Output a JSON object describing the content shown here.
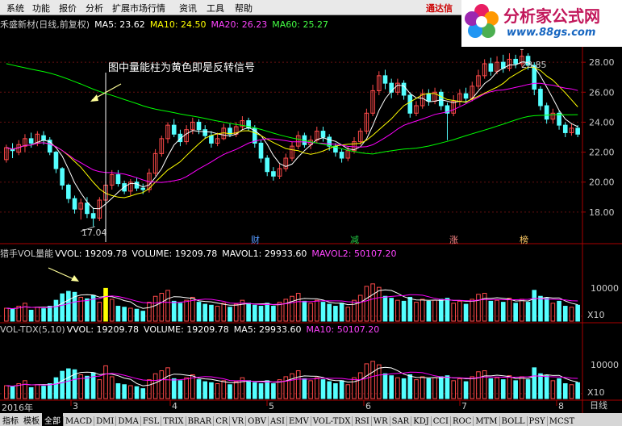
{
  "menu": [
    "系统",
    "功能",
    "报价",
    "分析",
    "扩展市场行情",
    "资讯",
    "工具",
    "帮助"
  ],
  "menu_brand": "通达信",
  "logo": {
    "name": "分析家公式网",
    "url": "www.88gs.com"
  },
  "colors": {
    "up": "#ff4a4a",
    "down": "#54ffff",
    "ma5": "#ffffff",
    "ma10": "#ffff00",
    "ma20": "#ff00ff",
    "ma60": "#00ff00",
    "vol_special": "#ffff00",
    "label": "#cccccc",
    "axis": "#aa0000"
  },
  "price_panel": {
    "title": "禾盛新材(日线,前复权)",
    "ma5_label": "MA5: 23.62",
    "ma10_label": "MA10: 24.50",
    "ma20_label": "MA20: 26.23",
    "ma60_label": "MA60: 25.27",
    "annotation": "图中量能柱为黄色即是反转信号",
    "low_marker": "17.04",
    "high_marker": "28.85",
    "flags": [
      {
        "text": "财",
        "color": "#5599ff"
      },
      {
        "text": "减",
        "color": "#22cc44"
      },
      {
        "text": "涨",
        "color": "#ff8888"
      },
      {
        "text": "榜",
        "color": "#ffcc66"
      }
    ]
  },
  "vol_panel": {
    "title": "猎手VOL量能",
    "vvol_label": "VVOL: 19209.78",
    "volume_label": "VOLUME: 19209.78",
    "mavol1_label": "MAVOL1: 29933.60",
    "mavol2_label": "MAVOL2: 50107.20",
    "tick": "10000",
    "unit": "X10"
  },
  "tdx_panel": {
    "title": "VOL-TDX(5,10)",
    "vvol_label": "VVOL: 19209.78",
    "volume_label": "VOLUME: 19209.78",
    "ma5_label": "MA5: 29933.60",
    "ma10_label": "MA10: 50107.20",
    "tick": "10000",
    "unit": "X10"
  },
  "bottom_bar": {
    "tabs": [
      "指标",
      "模板",
      "全部"
    ],
    "indicators": [
      "MACD",
      "DMI",
      "DMA",
      "FSL",
      "TRIX",
      "BRAR",
      "CR",
      "VR",
      "OBV",
      "ASI",
      "EMV",
      "VOL-TDX",
      "RSI",
      "WR",
      "SAR",
      "KDJ",
      "CCI",
      "ROC",
      "MTM",
      "BOLL",
      "PSY",
      "MCST"
    ],
    "period": "日线"
  },
  "x_labels": [
    "2016年",
    "3",
    "4",
    "5",
    "6",
    "7",
    "8"
  ],
  "chart_data": {
    "type": "candlestick",
    "ylim": [
      16.0,
      30.0
    ],
    "y_ticks": [
      "18.00",
      "20.00",
      "22.00",
      "24.00",
      "26.00",
      "28.00"
    ],
    "candles": [
      [
        21.5,
        22.3,
        21.3,
        22.5
      ],
      [
        22.2,
        22.1,
        21.6,
        22.6
      ],
      [
        22.0,
        22.5,
        21.8,
        22.8
      ],
      [
        22.4,
        22.9,
        22.0,
        23.2
      ],
      [
        22.9,
        22.6,
        22.3,
        23.3
      ],
      [
        22.6,
        23.2,
        22.4,
        23.4
      ],
      [
        23.1,
        22.8,
        22.5,
        23.4
      ],
      [
        22.8,
        22.0,
        21.8,
        23.0
      ],
      [
        22.0,
        20.9,
        20.6,
        22.1
      ],
      [
        20.9,
        19.8,
        19.5,
        21.0
      ],
      [
        19.8,
        18.9,
        18.6,
        19.9
      ],
      [
        18.9,
        18.2,
        17.9,
        19.1
      ],
      [
        18.2,
        18.6,
        17.5,
        18.9
      ],
      [
        18.6,
        17.9,
        17.6,
        19.0
      ],
      [
        17.9,
        17.6,
        17.04,
        18.3
      ],
      [
        17.6,
        18.8,
        17.4,
        19.0
      ],
      [
        18.8,
        19.8,
        18.6,
        20.0
      ],
      [
        19.8,
        20.5,
        19.5,
        20.8
      ],
      [
        20.5,
        19.9,
        19.7,
        20.8
      ],
      [
        19.9,
        19.4,
        19.2,
        20.1
      ],
      [
        19.4,
        20.0,
        19.1,
        20.2
      ],
      [
        20.0,
        19.6,
        19.4,
        20.3
      ],
      [
        19.6,
        19.5,
        19.2,
        19.9
      ],
      [
        19.5,
        20.6,
        19.3,
        20.9
      ],
      [
        20.6,
        21.9,
        20.4,
        22.2
      ],
      [
        21.9,
        22.9,
        21.7,
        23.1
      ],
      [
        22.9,
        23.8,
        22.6,
        24.0
      ],
      [
        23.8,
        23.2,
        23.0,
        24.2
      ],
      [
        23.2,
        22.7,
        22.4,
        23.5
      ],
      [
        22.7,
        23.5,
        22.5,
        23.8
      ],
      [
        23.5,
        24.0,
        23.2,
        24.3
      ],
      [
        24.0,
        23.5,
        23.2,
        24.2
      ],
      [
        23.5,
        23.1,
        22.9,
        23.8
      ],
      [
        23.1,
        22.6,
        22.3,
        23.4
      ],
      [
        22.6,
        22.9,
        22.4,
        23.3
      ],
      [
        22.9,
        23.6,
        22.8,
        23.9
      ],
      [
        23.6,
        23.2,
        23.0,
        23.9
      ],
      [
        23.2,
        23.7,
        23.0,
        24.0
      ],
      [
        23.7,
        24.1,
        23.5,
        24.4
      ],
      [
        24.1,
        23.6,
        23.4,
        24.3
      ],
      [
        23.6,
        22.6,
        22.3,
        23.8
      ],
      [
        22.6,
        21.6,
        21.3,
        22.8
      ],
      [
        21.6,
        20.7,
        20.4,
        21.8
      ],
      [
        20.7,
        20.4,
        20.1,
        21.0
      ],
      [
        20.4,
        20.9,
        20.2,
        21.2
      ],
      [
        20.9,
        21.6,
        20.7,
        21.9
      ],
      [
        21.6,
        22.4,
        21.4,
        22.7
      ],
      [
        22.4,
        23.1,
        22.2,
        23.4
      ],
      [
        23.1,
        22.5,
        22.3,
        23.3
      ],
      [
        22.5,
        22.8,
        22.2,
        23.1
      ],
      [
        22.8,
        23.4,
        22.6,
        23.7
      ],
      [
        23.4,
        23.0,
        22.7,
        23.7
      ],
      [
        23.0,
        22.4,
        22.1,
        23.2
      ],
      [
        22.4,
        22.0,
        21.7,
        22.6
      ],
      [
        22.0,
        21.6,
        21.3,
        22.2
      ],
      [
        21.6,
        22.1,
        21.4,
        22.4
      ],
      [
        22.1,
        22.7,
        21.9,
        23.0
      ],
      [
        22.7,
        23.4,
        22.5,
        23.6
      ],
      [
        23.4,
        24.6,
        23.2,
        24.9
      ],
      [
        24.6,
        26.1,
        24.4,
        26.5
      ],
      [
        26.1,
        27.1,
        25.8,
        27.4
      ],
      [
        27.1,
        26.6,
        26.2,
        27.5
      ],
      [
        26.6,
        26.0,
        25.6,
        26.9
      ],
      [
        26.0,
        26.6,
        25.8,
        26.9
      ],
      [
        26.6,
        25.8,
        25.5,
        26.8
      ],
      [
        25.8,
        24.6,
        24.3,
        26.0
      ],
      [
        24.6,
        25.1,
        24.4,
        25.4
      ],
      [
        25.1,
        25.9,
        24.9,
        26.2
      ],
      [
        25.9,
        25.4,
        25.1,
        26.2
      ],
      [
        25.4,
        26.0,
        25.2,
        26.3
      ],
      [
        26.0,
        25.1,
        24.8,
        26.2
      ],
      [
        25.1,
        24.6,
        22.8,
        25.3
      ],
      [
        24.6,
        25.4,
        24.4,
        25.8
      ],
      [
        25.4,
        25.9,
        25.1,
        26.2
      ],
      [
        25.9,
        25.6,
        25.3,
        26.3
      ],
      [
        25.6,
        26.4,
        25.4,
        26.7
      ],
      [
        26.4,
        27.1,
        26.2,
        27.5
      ],
      [
        27.1,
        27.9,
        26.9,
        28.2
      ],
      [
        27.9,
        27.4,
        27.1,
        28.3
      ],
      [
        27.4,
        28.0,
        27.2,
        28.4
      ],
      [
        28.0,
        27.6,
        27.3,
        28.5
      ],
      [
        27.6,
        28.2,
        27.4,
        28.6
      ],
      [
        28.2,
        27.9,
        27.6,
        28.5
      ],
      [
        27.9,
        28.4,
        27.7,
        28.85
      ],
      [
        28.4,
        27.8,
        27.5,
        28.6
      ],
      [
        27.8,
        26.2,
        25.8,
        28.0
      ],
      [
        26.2,
        25.1,
        24.8,
        26.4
      ],
      [
        25.1,
        24.2,
        23.9,
        25.3
      ],
      [
        24.2,
        24.6,
        23.9,
        24.9
      ],
      [
        24.6,
        23.8,
        23.5,
        24.8
      ],
      [
        23.8,
        23.3,
        23.0,
        24.0
      ],
      [
        23.3,
        23.6,
        23.1,
        23.9
      ],
      [
        23.6,
        23.2,
        23.0,
        23.8
      ]
    ],
    "volume": [
      26000,
      24000,
      30000,
      36000,
      22000,
      28000,
      25000,
      30000,
      42000,
      55000,
      60000,
      58000,
      48000,
      45000,
      52000,
      38000,
      66000,
      44000,
      30000,
      28000,
      26000,
      24000,
      20000,
      38000,
      50000,
      56000,
      62000,
      40000,
      36000,
      42000,
      48000,
      38000,
      34000,
      32000,
      30000,
      36000,
      28000,
      34000,
      42000,
      36000,
      32000,
      30000,
      36000,
      30000,
      38000,
      44000,
      50000,
      56000,
      40000,
      36000,
      42000,
      38000,
      34000,
      30000,
      36000,
      28000,
      42000,
      52000,
      70000,
      75000,
      68000,
      50000,
      46000,
      42000,
      40000,
      48000,
      38000,
      44000,
      40000,
      42000,
      44000,
      46000,
      36000,
      40000,
      34000,
      44000,
      54000,
      56000,
      40000,
      42000,
      38000,
      46000,
      36000,
      44000,
      38000,
      62000,
      50000,
      46000,
      36000,
      40000,
      30000,
      28000,
      32000
    ],
    "vol_ylim": [
      0,
      130000
    ],
    "highlight_index": 16
  }
}
